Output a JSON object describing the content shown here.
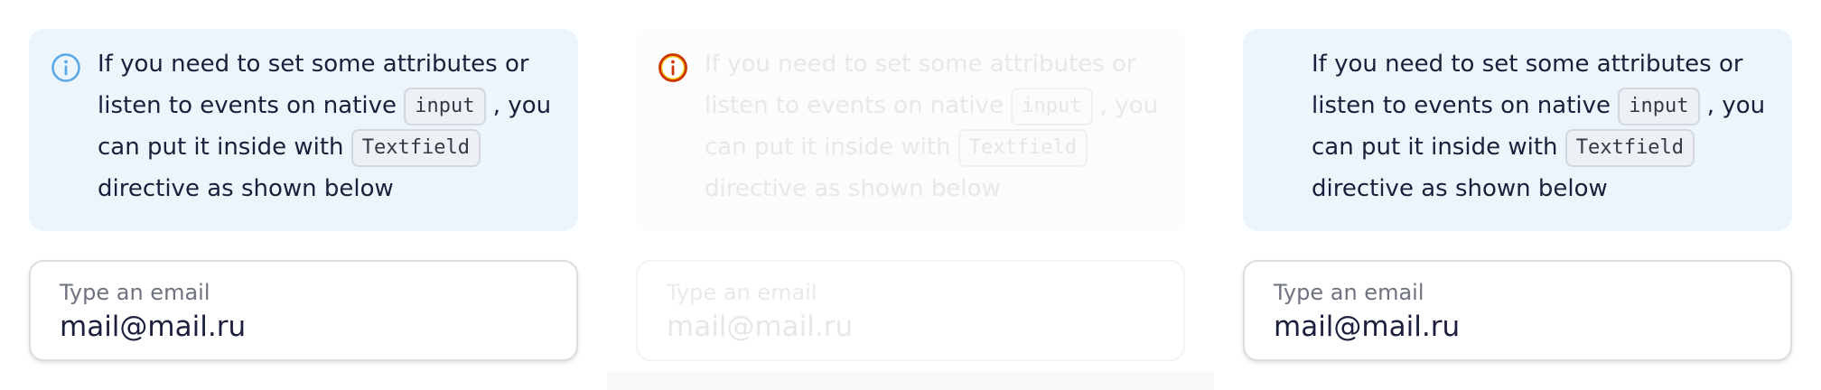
{
  "colors": {
    "notice_bg": "#edf5fc",
    "info_icon_blue": "#5aa9e6",
    "info_icon_disabled_red": "#cc3300",
    "info_icon_disabled_yellow": "#f2c400",
    "text": "#1b1f3b",
    "label": "#6f7380"
  },
  "panels": [
    {
      "state": "default",
      "notice": {
        "icon": "info-icon",
        "text_before": "If you need to set some attributes or listen to events on native",
        "code1": "input",
        "text_middle": ", you can put it inside with",
        "code2": "Textfield",
        "text_after": "directive as shown below"
      },
      "field": {
        "label": "Type an email",
        "value": "mail@mail.ru"
      }
    },
    {
      "state": "disabled",
      "notice": {
        "icon": "info-icon",
        "text_before": "If you need to set some attributes or listen to events on native",
        "code1": "input",
        "text_middle": ", you can put it inside with",
        "code2": "Textfield",
        "text_after": "directive as shown below"
      },
      "field": {
        "label": "Type an email",
        "value": "mail@mail.ru"
      }
    },
    {
      "state": "no-icon",
      "notice": {
        "icon": "",
        "text_before": "If you need to set some attributes or listen to events on native",
        "code1": "input",
        "text_middle": ", you can put it inside with",
        "code2": "Textfield",
        "text_after": "directive as shown below"
      },
      "field": {
        "label": "Type an email",
        "value": "mail@mail.ru"
      }
    }
  ]
}
